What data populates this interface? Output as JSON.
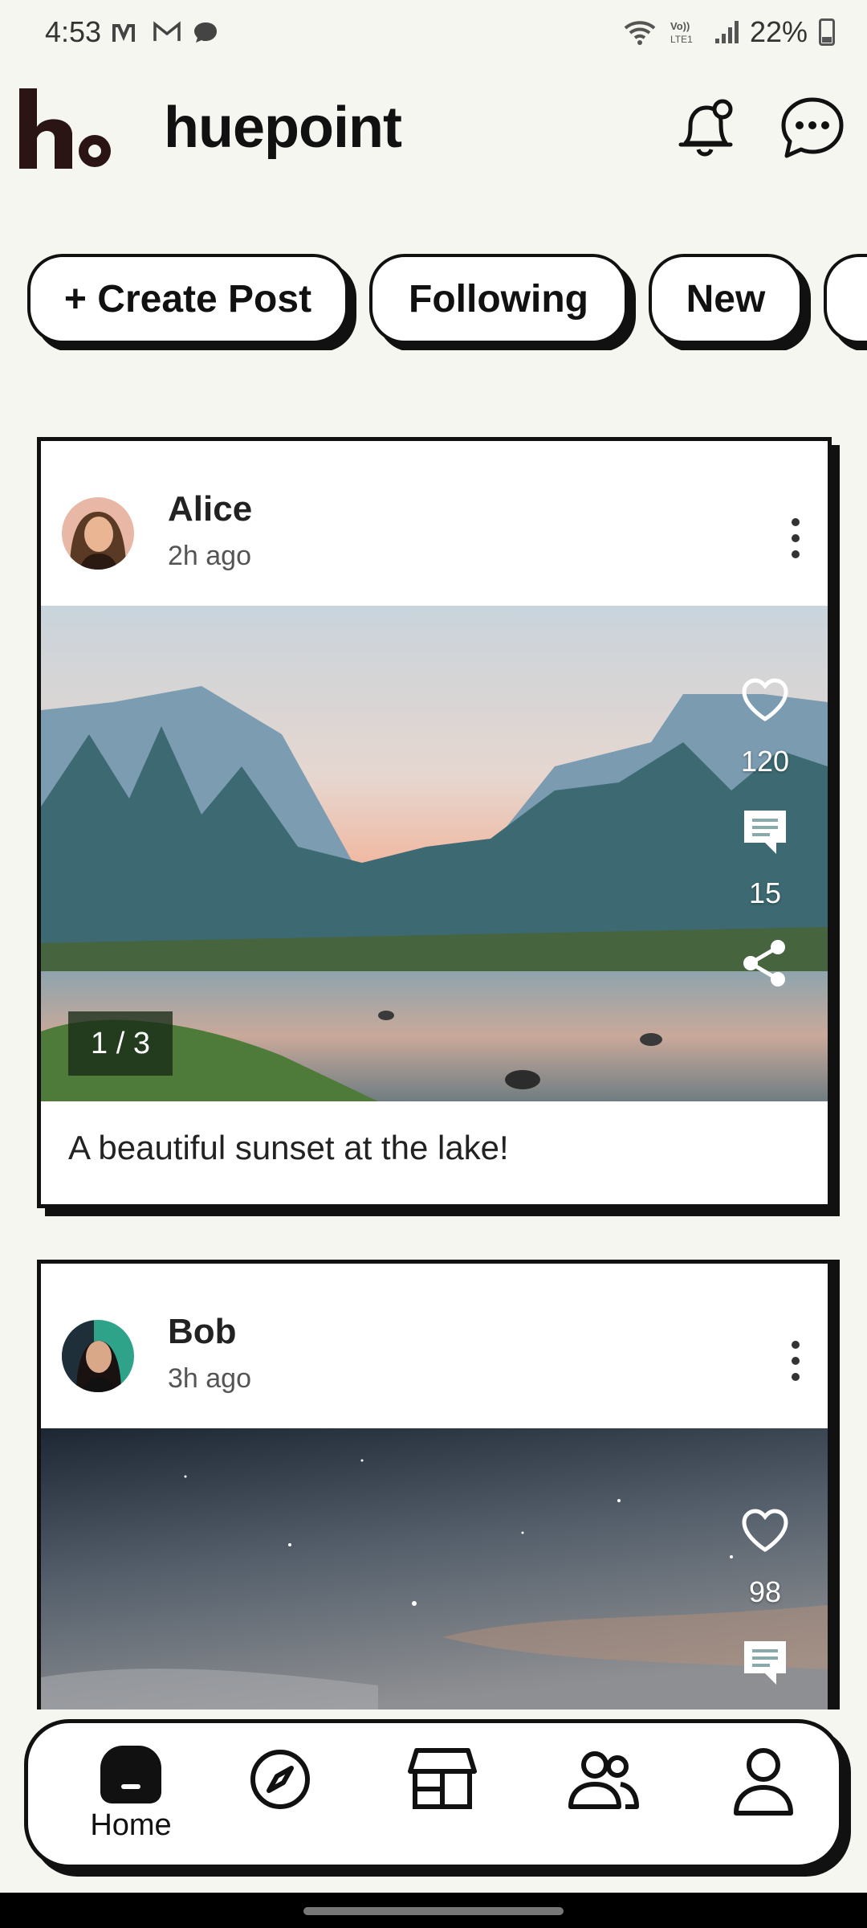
{
  "status_bar": {
    "time": "4:53",
    "battery_percent": "22%",
    "icons": [
      "medium-icon",
      "gmail-icon",
      "messages-icon",
      "wifi-icon",
      "volte-icon",
      "signal-icon",
      "battery-icon"
    ]
  },
  "header": {
    "app_name": "huepoint",
    "logo_icon": "huepoint-logo",
    "notifications_icon": "bell-icon",
    "messages_icon": "chat-bubble-icon"
  },
  "filters": {
    "chips": [
      {
        "label": "+ Create Post"
      },
      {
        "label": "Following"
      },
      {
        "label": "New"
      }
    ]
  },
  "feed": {
    "posts": [
      {
        "user": "Alice",
        "time": "2h ago",
        "likes": "120",
        "comments": "15",
        "page_indicator": "1 / 3",
        "caption": "A beautiful sunset at the lake!"
      },
      {
        "user": "Bob",
        "time": "3h ago",
        "likes": "98"
      }
    ]
  },
  "bottom_nav": {
    "items": [
      {
        "label": "Home",
        "icon": "home-icon",
        "active": true
      },
      {
        "icon": "compass-icon"
      },
      {
        "icon": "store-icon"
      },
      {
        "icon": "people-icon"
      },
      {
        "icon": "profile-icon"
      }
    ]
  },
  "colors": {
    "background": "#f5f6ef",
    "ink": "#111111",
    "card": "#ffffff"
  }
}
